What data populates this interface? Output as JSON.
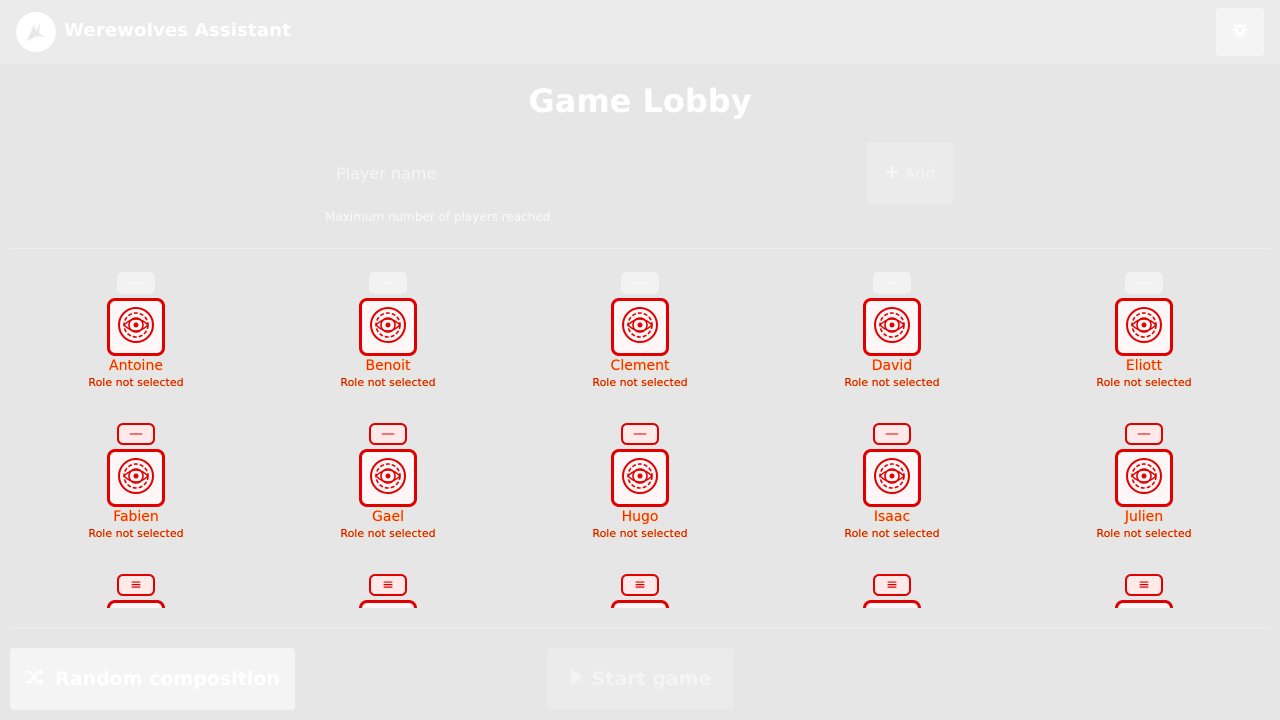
{
  "header": {
    "app_title": "Werewolves Assistant",
    "logo_icon": "werewolf-logo-icon",
    "settings_icon": "gear-icon"
  },
  "lobby": {
    "title": "Game Lobby",
    "name_input": {
      "value": "",
      "placeholder": "Player name"
    },
    "add_button": {
      "label": "Add",
      "icon": "plus-icon"
    },
    "hint": "Maximum number of players reached"
  },
  "players": [
    {
      "name": "Antoine",
      "role_status": "Role not selected"
    },
    {
      "name": "Benoit",
      "role_status": "Role not selected"
    },
    {
      "name": "Clement",
      "role_status": "Role not selected"
    },
    {
      "name": "David",
      "role_status": "Role not selected"
    },
    {
      "name": "Eliott",
      "role_status": "Role not selected"
    },
    {
      "name": "Fabien",
      "role_status": "Role not selected"
    },
    {
      "name": "Gael",
      "role_status": "Role not selected"
    },
    {
      "name": "Hugo",
      "role_status": "Role not selected"
    },
    {
      "name": "Isaac",
      "role_status": "Role not selected"
    },
    {
      "name": "Julien",
      "role_status": "Role not selected"
    },
    {
      "name": "",
      "role_status": ""
    },
    {
      "name": "",
      "role_status": ""
    },
    {
      "name": "",
      "role_status": ""
    },
    {
      "name": "",
      "role_status": ""
    },
    {
      "name": "",
      "role_status": ""
    }
  ],
  "footer": {
    "random_button": {
      "label": "Random composition",
      "icon": "shuffle-icon"
    },
    "start_button": {
      "label": "Start game",
      "icon": "play-icon"
    }
  },
  "colors": {
    "background": "#e6e6e6",
    "role_card_border": "#e00000",
    "name_text": "#ff2200"
  }
}
